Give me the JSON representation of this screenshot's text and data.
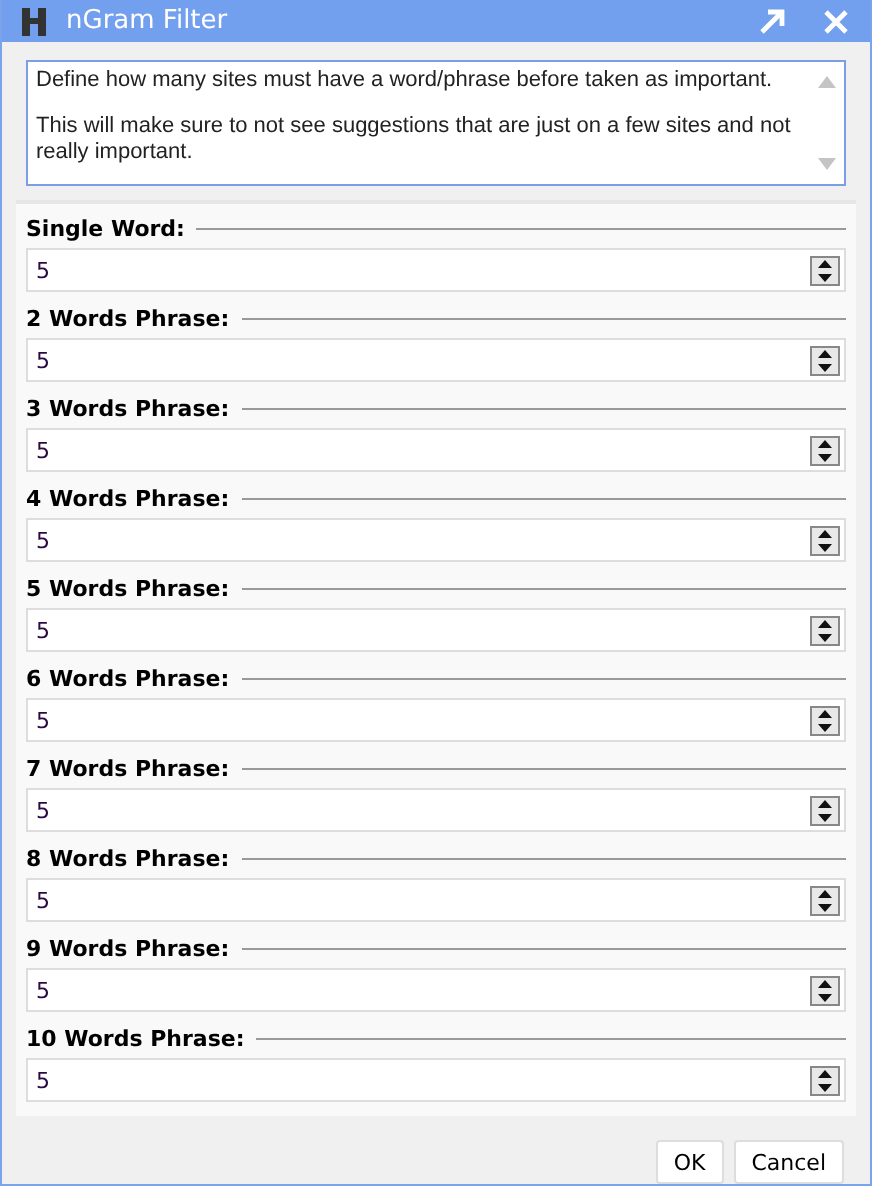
{
  "window": {
    "title": "nGram Filter"
  },
  "description": [
    "Define how many sites must have a word/phrase before taken as important.",
    "This will make sure to not see suggestions that are just on a few sites and not really important."
  ],
  "fields": [
    {
      "label": "Single Word:",
      "value": "5"
    },
    {
      "label": "2 Words Phrase:",
      "value": "5"
    },
    {
      "label": "3 Words Phrase:",
      "value": "5"
    },
    {
      "label": "4 Words Phrase:",
      "value": "5"
    },
    {
      "label": "5 Words Phrase:",
      "value": "5"
    },
    {
      "label": "6 Words Phrase:",
      "value": "5"
    },
    {
      "label": "7 Words Phrase:",
      "value": "5"
    },
    {
      "label": "8 Words Phrase:",
      "value": "5"
    },
    {
      "label": "9 Words Phrase:",
      "value": "5"
    },
    {
      "label": "10 Words Phrase:",
      "value": "5"
    }
  ],
  "buttons": [
    "OK",
    "Cancel"
  ]
}
